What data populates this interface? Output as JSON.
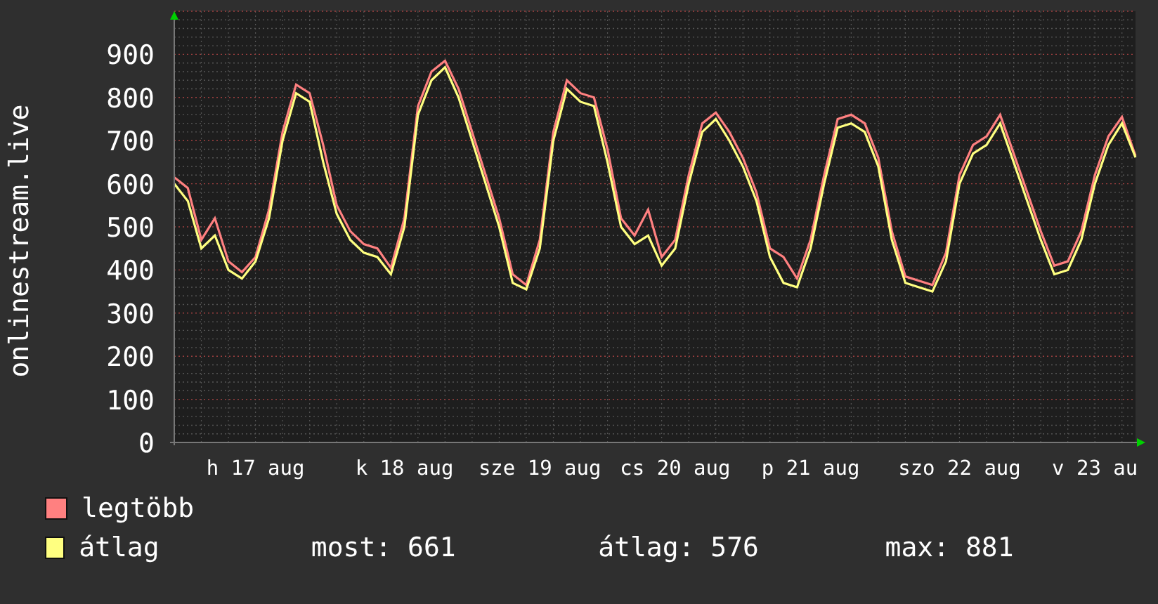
{
  "chart": {
    "chart_data": {
      "type": "line",
      "ylabel": "onlinestream.live",
      "categories": [
        null,
        null,
        null,
        null,
        null,
        null,
        "h 17 aug",
        null,
        null,
        null,
        null,
        null,
        null,
        null,
        null,
        null,
        null,
        "k 18 aug",
        null,
        null,
        null,
        null,
        null,
        null,
        null,
        null,
        null,
        "sze 19 aug",
        null,
        null,
        null,
        null,
        null,
        null,
        null,
        null,
        null,
        "cs 20 aug",
        null,
        null,
        null,
        null,
        null,
        null,
        null,
        null,
        null,
        "p 21 aug",
        null,
        null,
        null,
        null,
        null,
        null,
        null,
        null,
        null,
        null,
        "szo 22 aug",
        null,
        null,
        null,
        null,
        null,
        null,
        null,
        null,
        null,
        "v 23 au",
        null,
        null,
        null
      ],
      "series": [
        {
          "name": "legtöbb",
          "color": "#ff8080",
          "values": [
            615,
            590,
            470,
            520,
            420,
            395,
            430,
            540,
            720,
            830,
            810,
            690,
            550,
            490,
            460,
            450,
            405,
            520,
            780,
            860,
            885,
            820,
            720,
            620,
            520,
            390,
            365,
            470,
            720,
            840,
            810,
            800,
            680,
            520,
            480,
            540,
            430,
            470,
            620,
            740,
            765,
            720,
            660,
            580,
            450,
            430,
            380,
            470,
            620,
            750,
            760,
            740,
            660,
            490,
            385,
            375,
            365,
            440,
            620,
            690,
            710,
            760,
            670,
            580,
            490,
            410,
            420,
            490,
            620,
            710,
            755,
            665
          ]
        },
        {
          "name": "átlag",
          "color": "#ffff80",
          "values": [
            600,
            560,
            450,
            480,
            400,
            380,
            420,
            520,
            700,
            810,
            790,
            650,
            530,
            470,
            440,
            430,
            390,
            500,
            760,
            840,
            870,
            800,
            700,
            600,
            500,
            370,
            355,
            450,
            700,
            820,
            790,
            780,
            650,
            500,
            460,
            480,
            410,
            450,
            600,
            720,
            750,
            700,
            640,
            560,
            430,
            370,
            360,
            450,
            600,
            730,
            740,
            720,
            640,
            470,
            370,
            360,
            350,
            420,
            600,
            670,
            690,
            740,
            650,
            560,
            470,
            390,
            400,
            470,
            600,
            690,
            740,
            661
          ]
        }
      ],
      "ylim": [
        0,
        1000
      ],
      "grid": true,
      "yticks": [
        0,
        100,
        200,
        300,
        400,
        500,
        600,
        700,
        800,
        900
      ]
    }
  },
  "legend": {
    "stats": [
      "most: 661",
      "átlag: 576",
      "max: 881"
    ]
  }
}
